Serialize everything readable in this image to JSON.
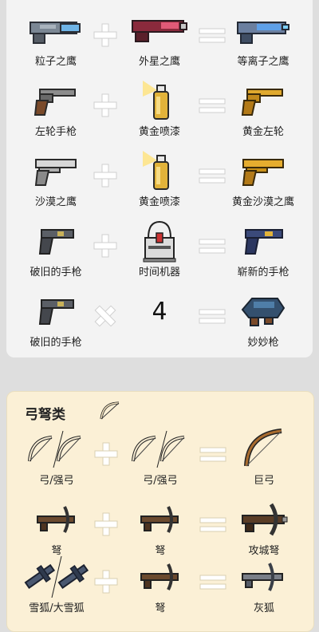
{
  "guns": [
    {
      "a": {
        "label": "粒子之鹰",
        "icon": "particle-eagle-gun-icon"
      },
      "op": "plus",
      "b": {
        "label": "外星之鹰",
        "icon": "alien-eagle-gun-icon"
      },
      "c": {
        "label": "等离子之鹰",
        "icon": "plasma-eagle-gun-icon"
      }
    },
    {
      "a": {
        "label": "左轮手枪",
        "icon": "revolver-icon"
      },
      "op": "plus",
      "b": {
        "label": "黄金喷漆",
        "icon": "gold-spray-paint-icon"
      },
      "c": {
        "label": "黄金左轮",
        "icon": "golden-revolver-icon"
      }
    },
    {
      "a": {
        "label": "沙漠之鹰",
        "icon": "desert-eagle-icon"
      },
      "op": "plus",
      "b": {
        "label": "黄金喷漆",
        "icon": "gold-spray-paint-icon"
      },
      "c": {
        "label": "黄金沙漠之鹰",
        "icon": "golden-desert-eagle-icon"
      }
    },
    {
      "a": {
        "label": "破旧的手枪",
        "icon": "old-pistol-icon"
      },
      "op": "plus",
      "b": {
        "label": "时间机器",
        "icon": "time-machine-icon"
      },
      "c": {
        "label": "崭新的手枪",
        "icon": "new-pistol-icon"
      }
    },
    {
      "a": {
        "label": "破旧的手枪",
        "icon": "old-pistol-icon"
      },
      "op": "times",
      "b": {
        "label": "",
        "number": "4"
      },
      "c": {
        "label": "妙妙枪",
        "icon": "magic-gun-icon"
      }
    }
  ],
  "bows": {
    "title": "弓弩类",
    "title_icon": "bow-icon",
    "rows": [
      {
        "a": {
          "label": "弓/强弓",
          "icon": "bow-pair-icon"
        },
        "b": {
          "label": "弓/强弓",
          "icon": "bow-pair-icon"
        },
        "c": {
          "label": "巨弓",
          "icon": "giant-bow-icon"
        }
      },
      {
        "a": {
          "label": "弩",
          "icon": "crossbow-icon"
        },
        "b": {
          "label": "弩",
          "icon": "crossbow-icon"
        },
        "c": {
          "label": "攻城弩",
          "icon": "siege-crossbow-icon"
        }
      },
      {
        "a": {
          "label": "雪狐/大雪狐",
          "icon": "snow-fox-pair-icon"
        },
        "b": {
          "label": "弩",
          "icon": "crossbow-icon"
        },
        "c": {
          "label": "灰狐",
          "icon": "grey-fox-crossbow-icon"
        }
      }
    ]
  },
  "colors": {
    "panel": "#f3f3f3",
    "bow_panel": "#fbf0d6",
    "background": "#dedede",
    "gold": "#d9a22a"
  }
}
